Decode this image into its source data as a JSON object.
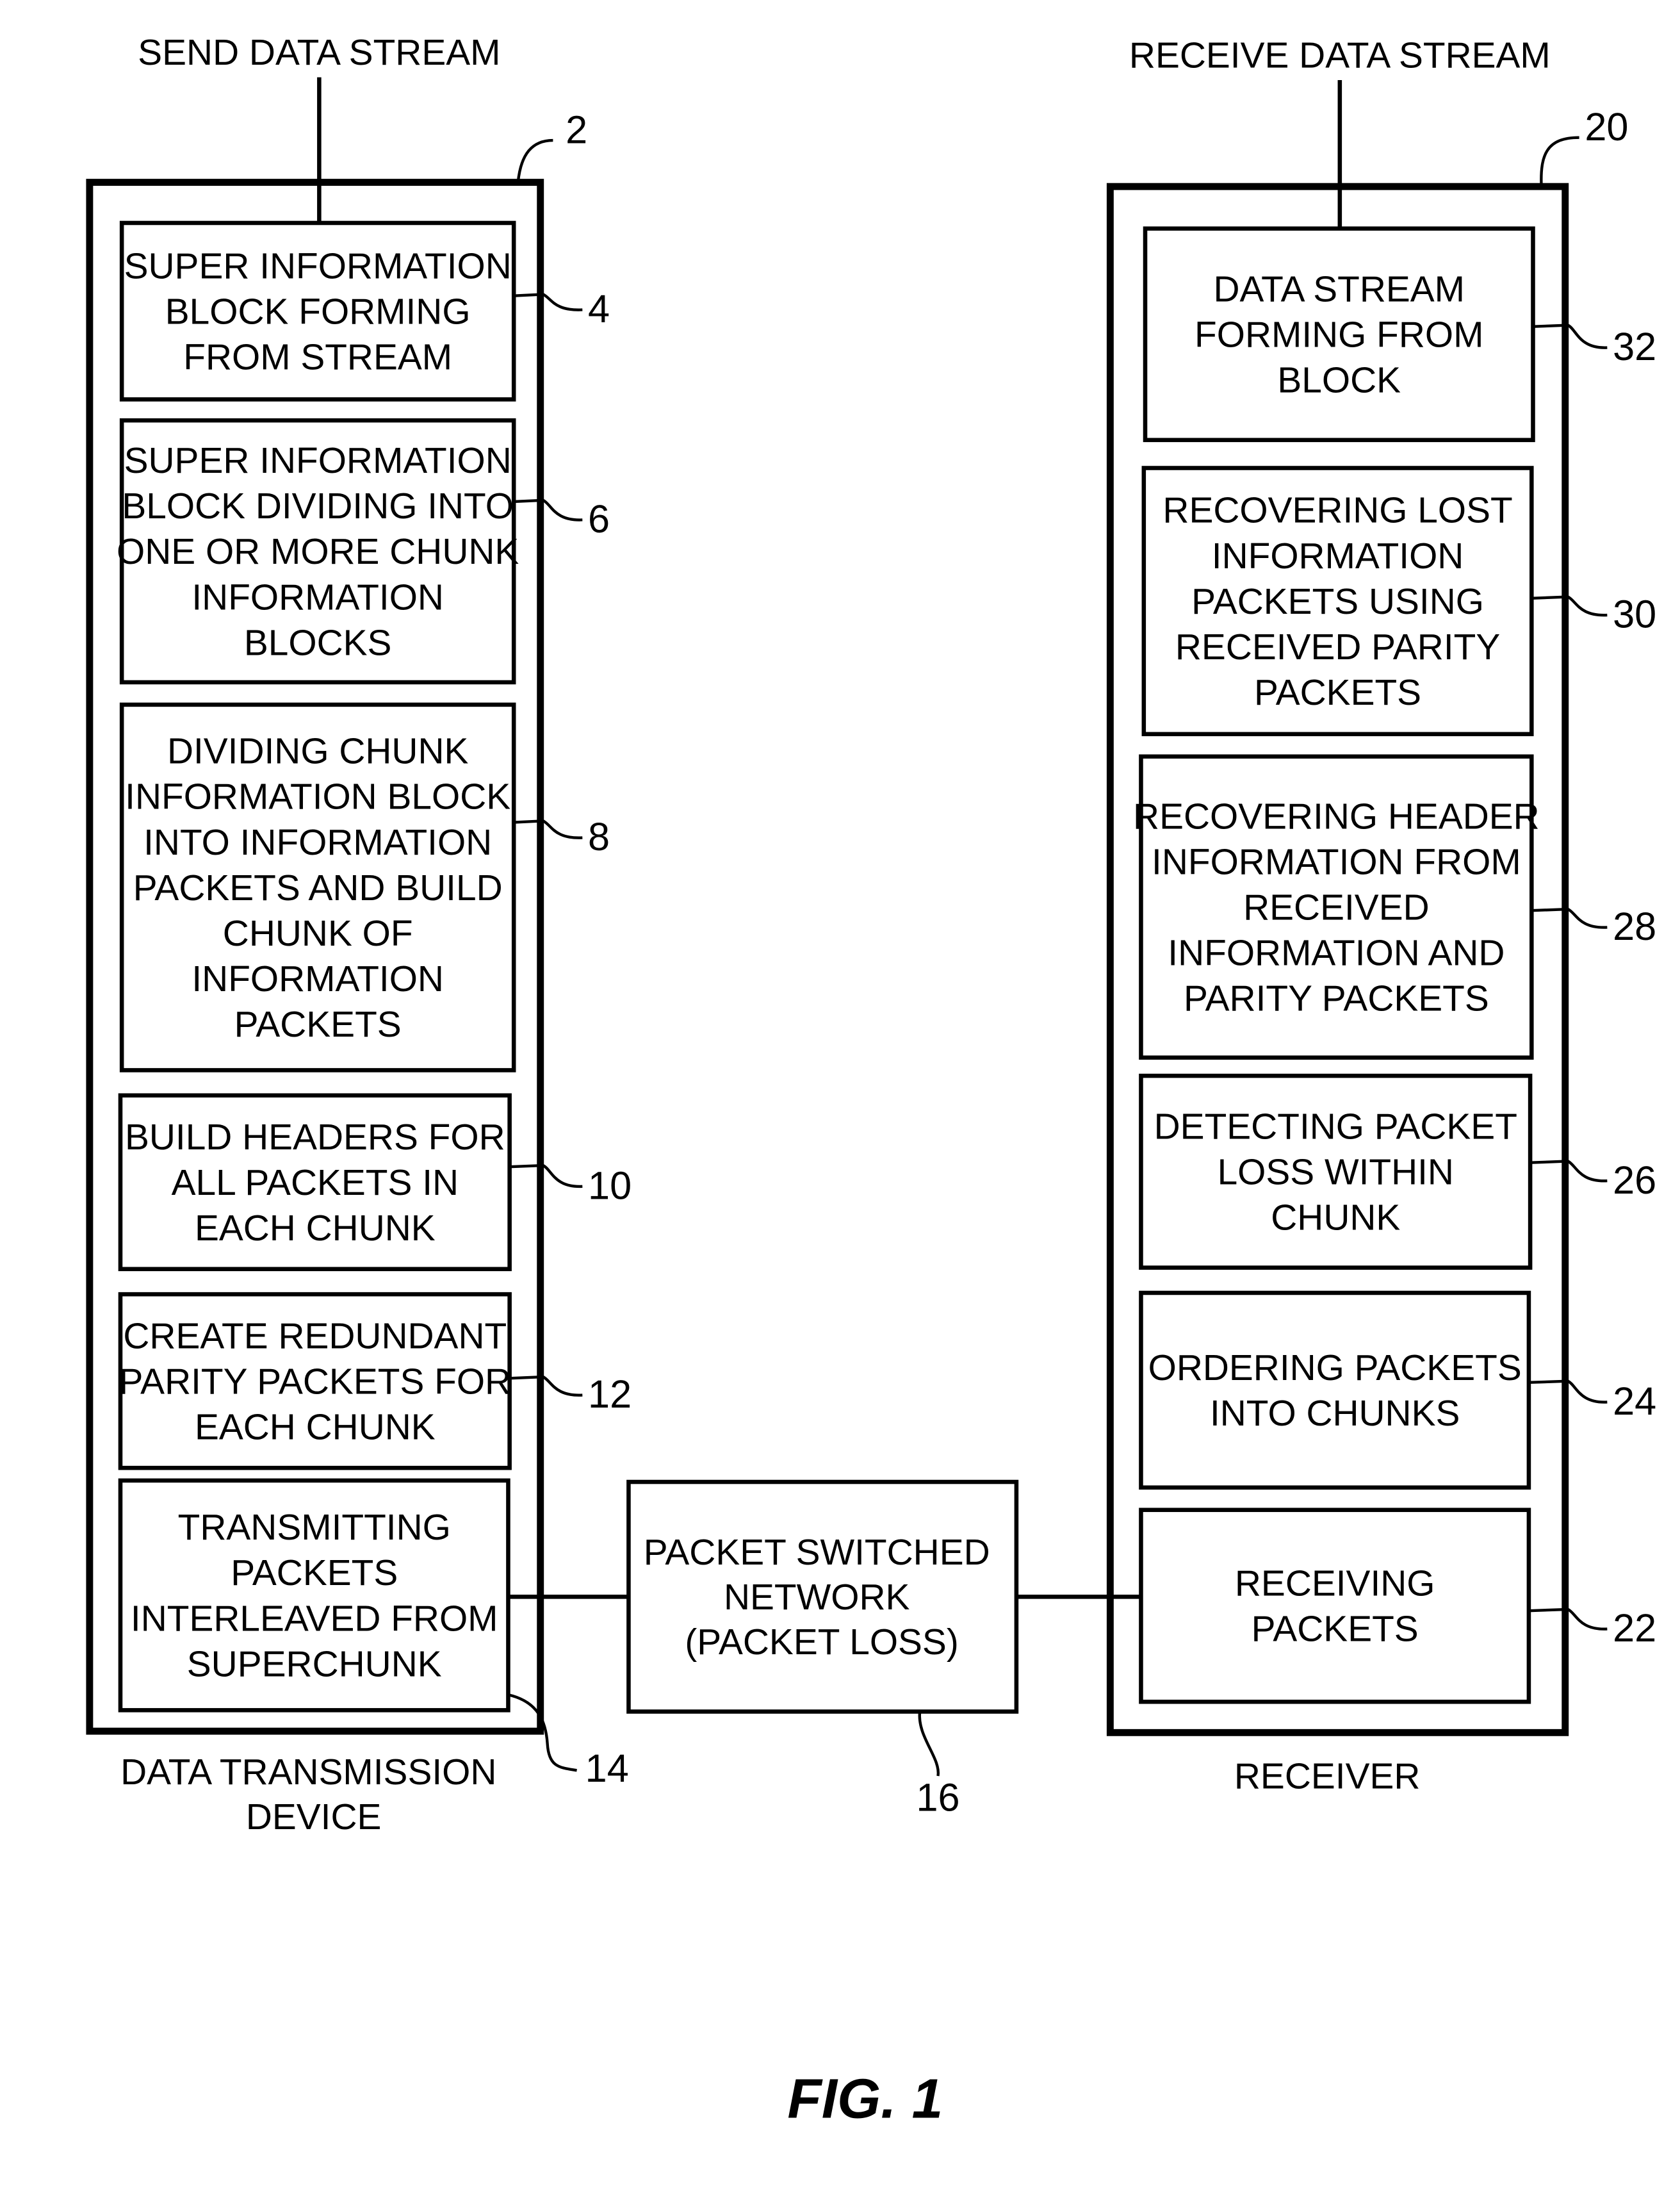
{
  "figure_label": "FIG. 1",
  "inputs": {
    "send": "SEND DATA STREAM",
    "receive": "RECEIVE DATA STREAM"
  },
  "transmitter": {
    "ref": "2",
    "caption": [
      "DATA TRANSMISSION",
      "DEVICE"
    ],
    "blocks": [
      {
        "ref": "4",
        "lines": [
          "SUPER INFORMATION",
          "BLOCK FORMING",
          "FROM STREAM"
        ]
      },
      {
        "ref": "6",
        "lines": [
          "SUPER INFORMATION",
          "BLOCK DIVIDING INTO",
          "ONE OR MORE CHUNK",
          "INFORMATION",
          "BLOCKS"
        ]
      },
      {
        "ref": "8",
        "lines": [
          "DIVIDING CHUNK",
          "INFORMATION BLOCK",
          "INTO INFORMATION",
          "PACKETS AND BUILD",
          "CHUNK OF",
          "INFORMATION",
          "PACKETS"
        ]
      },
      {
        "ref": "10",
        "lines": [
          "BUILD HEADERS FOR",
          "ALL PACKETS IN",
          "EACH CHUNK"
        ]
      },
      {
        "ref": "12",
        "lines": [
          "CREATE REDUNDANT",
          "PARITY PACKETS FOR",
          "EACH CHUNK"
        ]
      },
      {
        "ref": "14",
        "lines": [
          "TRANSMITTING",
          "PACKETS",
          "INTERLEAVED FROM",
          "SUPERCHUNK"
        ]
      }
    ]
  },
  "network": {
    "ref": "16",
    "lines": [
      "PACKET SWITCHED",
      "NETWORK",
      "(PACKET LOSS)"
    ]
  },
  "receiver": {
    "ref": "20",
    "caption": [
      "RECEIVER"
    ],
    "blocks": [
      {
        "ref": "32",
        "lines": [
          "DATA STREAM",
          "FORMING FROM",
          "BLOCK"
        ]
      },
      {
        "ref": "30",
        "lines": [
          "RECOVERING LOST",
          "INFORMATION",
          "PACKETS USING",
          "RECEIVED PARITY",
          "PACKETS"
        ]
      },
      {
        "ref": "28",
        "lines": [
          "RECOVERING HEADER",
          "INFORMATION FROM",
          "RECEIVED",
          "INFORMATION AND",
          "PARITY PACKETS"
        ]
      },
      {
        "ref": "26",
        "lines": [
          "DETECTING PACKET",
          "LOSS WITHIN",
          "CHUNK"
        ]
      },
      {
        "ref": "24",
        "lines": [
          "ORDERING PACKETS",
          "INTO CHUNKS"
        ]
      },
      {
        "ref": "22",
        "lines": [
          "RECEIVING",
          "PACKETS"
        ]
      }
    ]
  }
}
